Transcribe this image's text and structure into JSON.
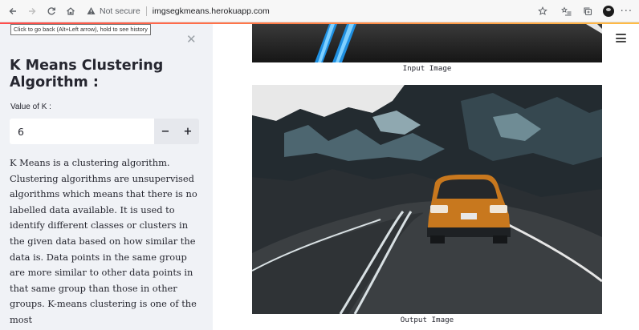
{
  "browser": {
    "security_label": "Not secure",
    "url": "imgsegkmeans.herokuapp.com",
    "tooltip": "Click to go back (Alt+Left arrow), hold to see history",
    "icons": [
      "back-arrow-icon",
      "forward-arrow-icon",
      "reload-icon",
      "home-icon",
      "warning-icon",
      "star-icon",
      "reading-list-icon",
      "collections-icon",
      "profile-avatar",
      "more-icon"
    ]
  },
  "sidebar": {
    "close_glyph": "✕",
    "title": "K Means Clustering Algorithm :",
    "k_label": "Value of K :",
    "k_value": "6",
    "minus_label": "−",
    "plus_label": "+",
    "description": "K Means is a clustering algorithm. Clustering algorithms are unsupervised algorithms which means that there is no labelled data available. It is used to identify different classes or clusters in the given data based on how similar the data is. Data points in the same group are more similar to other data points in that same group than those in other groups. K-means clustering is one of the most"
  },
  "main": {
    "input_caption": "Input Image",
    "output_caption": "Output Image"
  },
  "colors": {
    "accent": "#ff4b4b",
    "sidebar_bg": "#f0f2f6",
    "text": "#262730"
  }
}
